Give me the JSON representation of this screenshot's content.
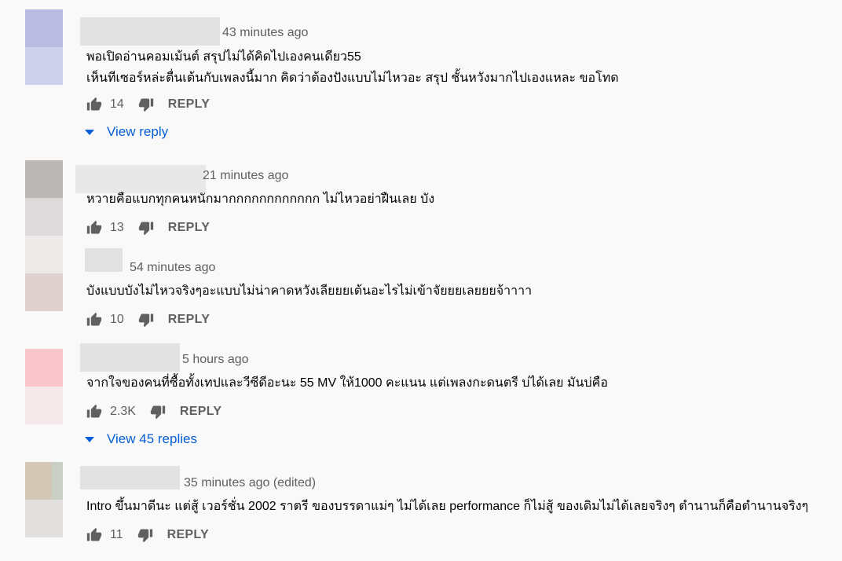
{
  "comments": [
    {
      "time": "43 minutes ago",
      "lines": [
        "พอเปิดอ่านคอมเม้นต์ สรุปไม่ได้คิดไปเองคนเดียว55",
        "เห็นทีเซอร์หล่ะตื่นเต้นกับเพลงนี้มาก คิดว่าต้องปังแบบไม่ไหวอะ สรุป ชั้นหวังมากไปเองแหละ ขอโทด"
      ],
      "likes": "14",
      "reply_label": "REPLY",
      "view_replies": "View reply"
    },
    {
      "time": "21 minutes ago",
      "lines": [
        "หวายคือแบกทุกคนหนักมากกกกกกกกกกกก ไม่ไหวอย่าฝืนเลย บัง"
      ],
      "likes": "13",
      "reply_label": "REPLY"
    },
    {
      "time": "54 minutes ago",
      "lines": [
        "บังแบบบังไม่ไหวจริงๆอะแบบไม่น่าคาดหวังเลียยยเต้นอะไรไม่เข้าจัยยยเลยยยจ้าาาา"
      ],
      "likes": "10",
      "reply_label": "REPLY"
    },
    {
      "time": "5 hours ago",
      "lines": [
        "จากใจของคนที่ซื้อทั้งเทปและวีซีดีอะนะ 55 MV ให้1000 คะแนน แต่เพลงกะดนตรี บ่ได้เลย มันบ่คือ"
      ],
      "likes": "2.3K",
      "reply_label": "REPLY",
      "view_replies": "View 45 replies"
    },
    {
      "time": "35 minutes ago (edited)",
      "lines": [
        "Intro ขึ้นมาดีนะ แต่สู้ เวอร์ชั่น 2002 ราตรี ของบรรดาแม่ๆ ไม่ได้เลย performance ก็ไม่สู้ ของเดิมไม่ได้เลยจริงๆ  ตำนานก็คือตำนานจริงๆ"
      ],
      "likes": "11",
      "reply_label": "REPLY"
    }
  ],
  "icons": {
    "like": "thumb-up-icon",
    "dislike": "thumb-down-icon",
    "expand": "caret-down-icon"
  },
  "colors": {
    "link": "#065fd4",
    "secondary_text": "#606060",
    "background": "#f9f9f9"
  }
}
